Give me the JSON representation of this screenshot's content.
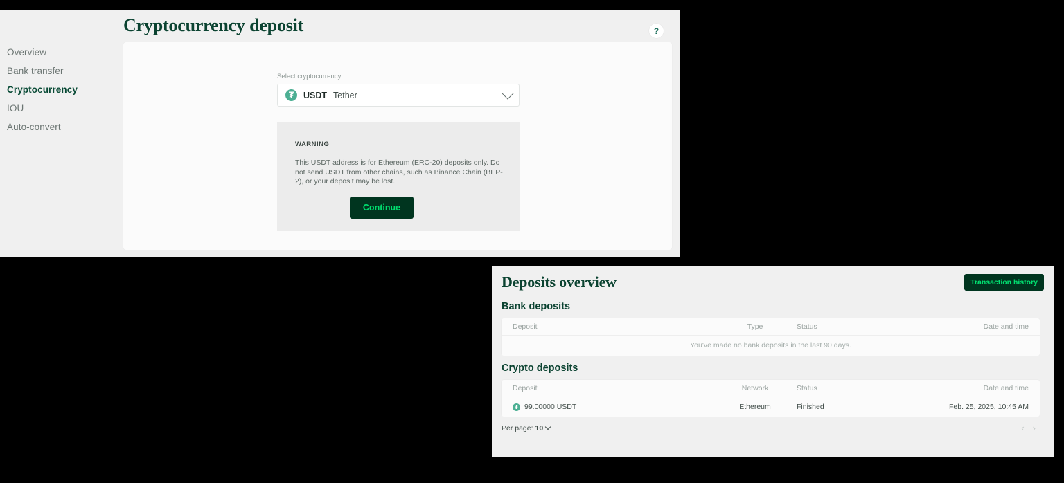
{
  "deposit_window": {
    "title": "Cryptocurrency deposit",
    "help_label": "?",
    "sidebar": {
      "items": [
        {
          "label": "Overview",
          "active": false
        },
        {
          "label": "Bank transfer",
          "active": false
        },
        {
          "label": "Cryptocurrency",
          "active": true
        },
        {
          "label": "IOU",
          "active": false
        },
        {
          "label": "Auto-convert",
          "active": false
        }
      ]
    },
    "form": {
      "select_label": "Select cryptocurrency",
      "selected_code": "USDT",
      "selected_name": "Tether",
      "icon": "tether-icon",
      "chevron": "chevron-down-icon"
    },
    "warning": {
      "title": "WARNING",
      "text": "This USDT address is for Ethereum (ERC-20) deposits only. Do not send USDT from other chains, such as Binance Chain (BEP-2), or your deposit may be lost.",
      "continue_label": "Continue"
    }
  },
  "overview_window": {
    "title": "Deposits overview",
    "transaction_history_label": "Transaction history",
    "bank_section": {
      "title": "Bank deposits",
      "columns": [
        "Deposit",
        "Type",
        "Status",
        "Date and time"
      ],
      "empty_message": "You've made no bank deposits in the last 90 days."
    },
    "crypto_section": {
      "title": "Crypto deposits",
      "columns": [
        "Deposit",
        "Network",
        "Status",
        "Date and time"
      ],
      "rows": [
        {
          "deposit": "99.00000 USDT",
          "network": "Ethereum",
          "status": "Finished",
          "date": "Feb. 25, 2025, 10:45 AM"
        }
      ]
    },
    "pagination": {
      "per_page_label": "Per page:",
      "per_page_value": "10",
      "prev_label": "‹",
      "next_label": "›"
    }
  },
  "colors": {
    "brand_dark_green": "#00351f",
    "brand_bright_green": "#00e070",
    "heading_green": "#0b4331",
    "tether_teal": "#4caf93"
  }
}
